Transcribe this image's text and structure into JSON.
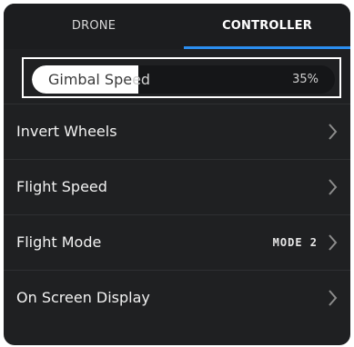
{
  "tabs": [
    {
      "label": "DRONE",
      "selected": false
    },
    {
      "label": "CONTROLLER",
      "selected": true
    }
  ],
  "colors": {
    "accent": "#2b8ef0",
    "panel_bg": "#1f2022",
    "text": "#f2f2f2"
  },
  "gimbal_speed": {
    "label": "Gimbal Speed",
    "label_part_on_fill": "Gimbal Spe",
    "label_part_off_fill": "ed",
    "value_text": "35%",
    "fill_fraction": 0.35
  },
  "settings": [
    {
      "label": "Invert Wheels",
      "value": "",
      "icon": "chevron-right-icon"
    },
    {
      "label": "Flight Speed",
      "value": "",
      "icon": "chevron-right-icon"
    },
    {
      "label": "Flight Mode",
      "value": "MODE 2",
      "icon": "chevron-right-icon"
    },
    {
      "label": "On Screen Display",
      "value": "",
      "icon": "chevron-right-icon"
    }
  ]
}
